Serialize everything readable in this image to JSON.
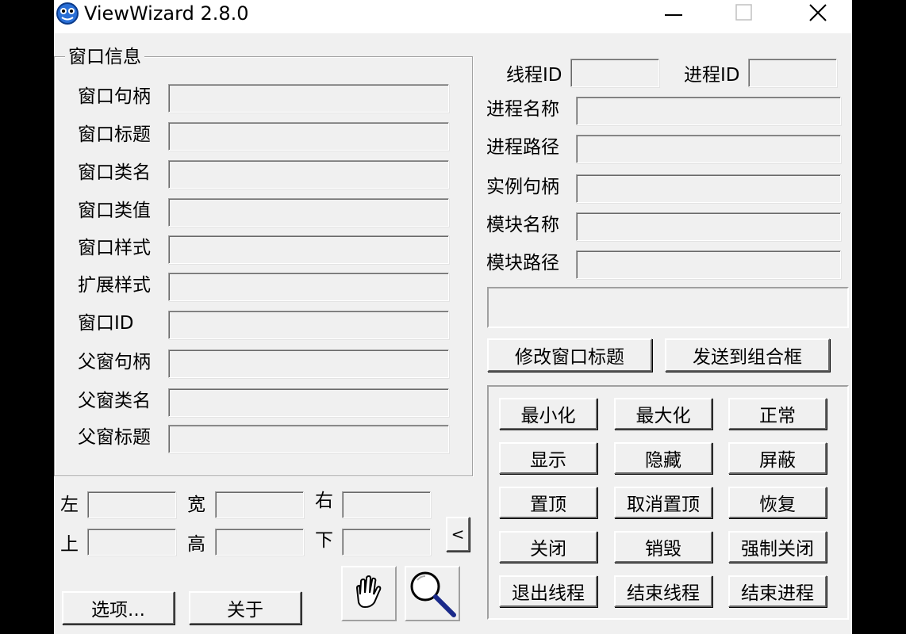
{
  "window": {
    "title": "ViewWizard 2.8.0"
  },
  "window_info": {
    "group_title": "窗口信息",
    "rows": [
      {
        "label": "窗口句柄"
      },
      {
        "label": "窗口标题"
      },
      {
        "label": "窗口类名"
      },
      {
        "label": "窗口类值"
      },
      {
        "label": "窗口样式"
      },
      {
        "label": "扩展样式"
      },
      {
        "label": "窗口ID"
      },
      {
        "label": "父窗句柄"
      },
      {
        "label": "父窗类名"
      },
      {
        "label": "父窗标题"
      }
    ]
  },
  "position": {
    "left": "左",
    "width": "宽",
    "right": "右",
    "top": "上",
    "height": "高",
    "bottom": "下"
  },
  "collapse_label": "<",
  "bottom_buttons": {
    "options": "选项...",
    "about": "关于"
  },
  "process_info": {
    "thread_id": "线程ID",
    "process_id": "进程ID",
    "rows": [
      {
        "label": "进程名称"
      },
      {
        "label": "进程路径"
      },
      {
        "label": "实例句柄"
      },
      {
        "label": "模块名称"
      },
      {
        "label": "模块路径"
      }
    ]
  },
  "action_buttons": {
    "modify_title": "修改窗口标题",
    "send_to_combo": "发送到组合框"
  },
  "control_buttons": [
    [
      "最小化",
      "最大化",
      "正常"
    ],
    [
      "显示",
      "隐藏",
      "屏蔽"
    ],
    [
      "置顶",
      "取消置顶",
      "恢复"
    ],
    [
      "关闭",
      "销毁",
      "强制关闭"
    ],
    [
      "退出线程",
      "结束线程",
      "结束进程"
    ]
  ]
}
